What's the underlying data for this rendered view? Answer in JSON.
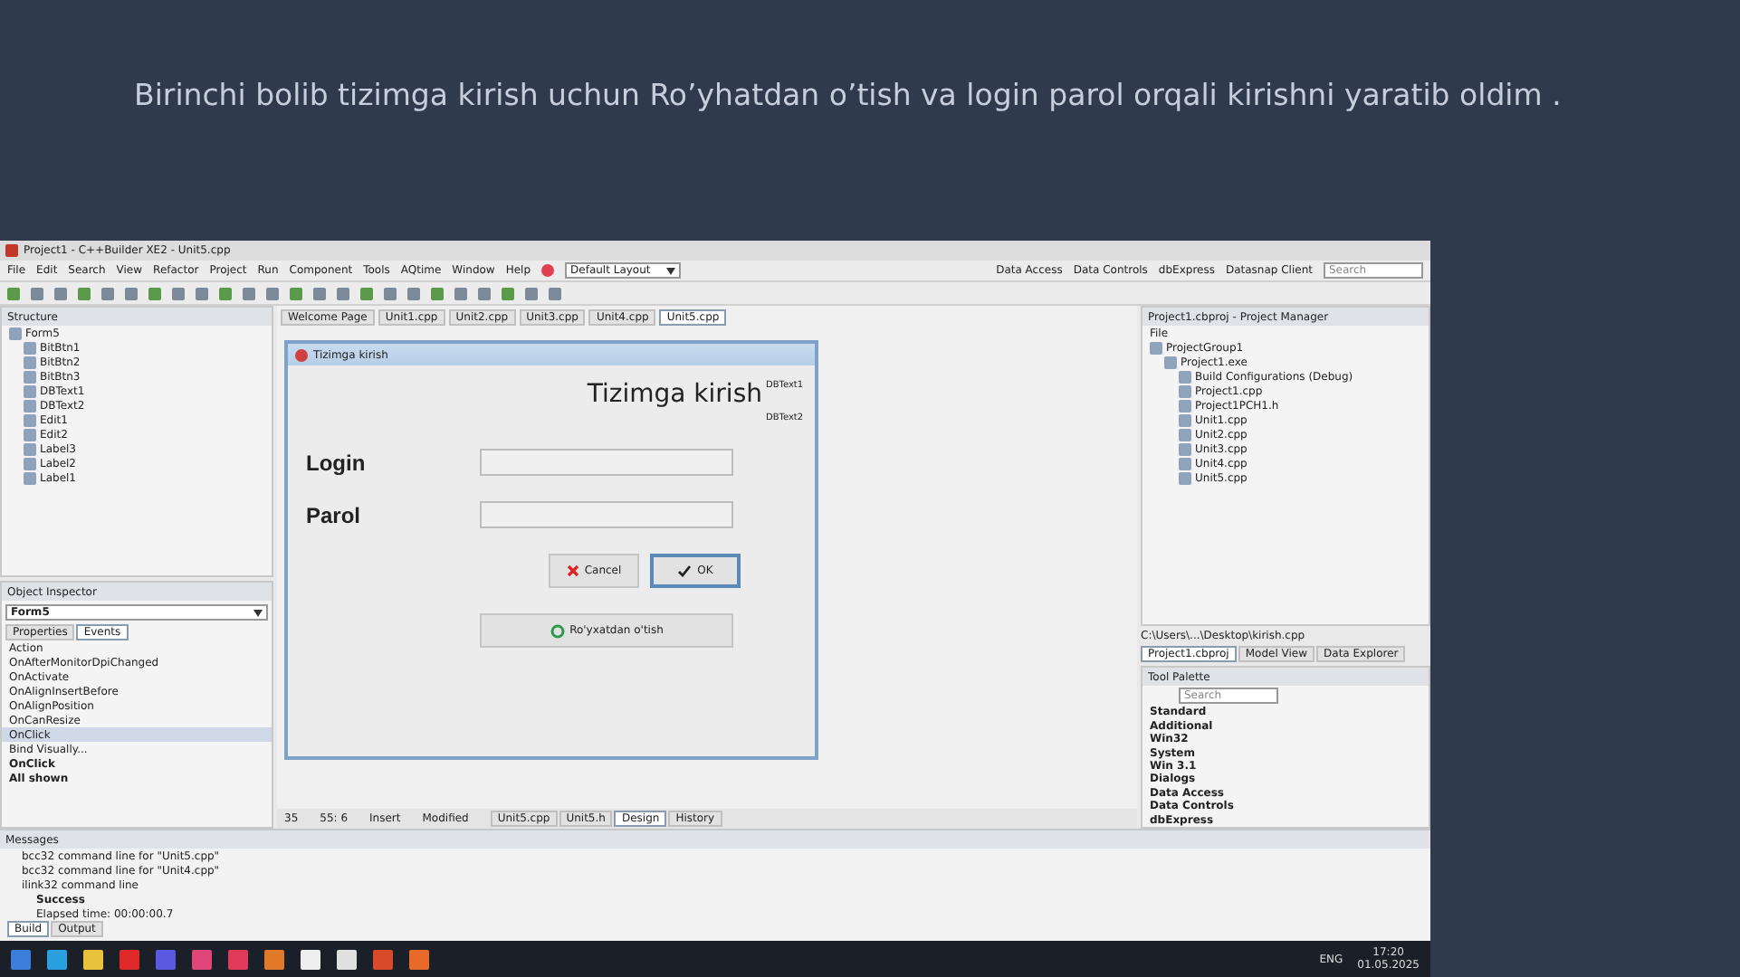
{
  "slide": {
    "title": "Birinchi bolib tizimga kirish uchun Ro’yhatdan o’tish va login parol orqali kirishni yaratib oldim ."
  },
  "ide": {
    "title": "Project1 - C++Builder XE2 - Unit5.cpp",
    "menu": [
      "File",
      "Edit",
      "Search",
      "View",
      "Refactor",
      "Project",
      "Run",
      "Component",
      "Tools",
      "AQtime",
      "Window",
      "Help"
    ],
    "layout": "Default Layout",
    "palette_tabs": [
      "Data Access",
      "Data Controls",
      "dbExpress",
      "Datasnap Client"
    ],
    "search_placeholder": "Search",
    "structure": {
      "title": "Structure",
      "tree": [
        {
          "label": "Form5",
          "children": [
            {
              "label": "BitBtn1"
            },
            {
              "label": "BitBtn2"
            },
            {
              "label": "BitBtn3"
            },
            {
              "label": "DBText1"
            },
            {
              "label": "DBText2"
            },
            {
              "label": "Edit1"
            },
            {
              "label": "Edit2"
            },
            {
              "label": "Label3"
            },
            {
              "label": "Label2"
            },
            {
              "label": "Label1"
            }
          ]
        }
      ]
    },
    "object_inspector": {
      "title": "Object Inspector",
      "object": "Form5",
      "tabs": [
        {
          "label": "Properties",
          "selected": false
        },
        {
          "label": "Events",
          "selected": true
        }
      ],
      "events": [
        {
          "name": "Action",
          "selected": false
        },
        {
          "name": "OnAfterMonitorDpiChanged",
          "selected": false
        },
        {
          "name": "OnActivate",
          "selected": false
        },
        {
          "name": "OnAlignInsertBefore",
          "selected": false
        },
        {
          "name": "OnAlignPosition",
          "selected": false
        },
        {
          "name": "OnCanResize",
          "selected": false
        },
        {
          "name": "OnClick",
          "selected": true
        }
      ],
      "bind": "Bind Visually...",
      "current": "OnClick",
      "filter": "All shown"
    },
    "editor_tabs": [
      {
        "label": "Welcome Page",
        "selected": false
      },
      {
        "label": "Unit1.cpp",
        "selected": false
      },
      {
        "label": "Unit2.cpp",
        "selected": false
      },
      {
        "label": "Unit3.cpp",
        "selected": false
      },
      {
        "label": "Unit4.cpp",
        "selected": false
      },
      {
        "label": "Unit5.cpp",
        "selected": true
      }
    ],
    "form": {
      "caption": "Tizimga kirish",
      "heading": "Tizimga kirish",
      "db_texts": [
        "DBText1",
        "DBText2"
      ],
      "fields": [
        {
          "label": "Login"
        },
        {
          "label": "Parol"
        }
      ],
      "buttons": [
        {
          "label": "Cancel",
          "kind": "cancel",
          "selected": false
        },
        {
          "label": "OK",
          "kind": "ok",
          "selected": true
        }
      ],
      "register_button": "Ro'yxatdan o'tish"
    },
    "status": {
      "line": "35",
      "pos": "55: 6",
      "mode": "Insert",
      "state": "Modified",
      "tabs": [
        {
          "label": "Unit5.cpp",
          "selected": false
        },
        {
          "label": "Unit5.h",
          "selected": false
        },
        {
          "label": "Design",
          "selected": true
        },
        {
          "label": "History",
          "selected": false
        }
      ]
    },
    "project_manager": {
      "title": "Project1.cbproj - Project Manager",
      "header": "File",
      "tree": [
        {
          "label": "ProjectGroup1",
          "children": [
            {
              "label": "Project1.exe",
              "children": [
                {
                  "label": "Build Configurations (Debug)"
                },
                {
                  "label": "Project1.cpp"
                },
                {
                  "label": "Project1PCH1.h"
                },
                {
                  "label": "Unit1.cpp"
                },
                {
                  "label": "Unit2.cpp"
                },
                {
                  "label": "Unit3.cpp"
                },
                {
                  "label": "Unit4.cpp"
                },
                {
                  "label": "Unit5.cpp"
                }
              ]
            }
          ]
        }
      ],
      "path": "C:\\Users\\...\\Desktop\\kirish.cpp",
      "tabs": [
        {
          "label": "Project1.cbproj",
          "selected": true
        },
        {
          "label": "Model View",
          "selected": false
        },
        {
          "label": "Data Explorer",
          "selected": false
        }
      ]
    },
    "tool_palette": {
      "title": "Tool Palette",
      "search_placeholder": "Search",
      "categories": [
        "Standard",
        "Additional",
        "Win32",
        "System",
        "Win 3.1",
        "Dialogs",
        "Data Access",
        "Data Controls",
        "dbExpress"
      ]
    },
    "messages": {
      "title": "Messages",
      "lines": [
        {
          "text": "bcc32 command line for \"Unit5.cpp\"",
          "kind": "cmd"
        },
        {
          "text": "bcc32 command line for \"Unit4.cpp\"",
          "kind": "cmd"
        },
        {
          "text": "ilink32 command line",
          "kind": "cmd"
        },
        {
          "text": "Success",
          "kind": "result"
        },
        {
          "text": "Elapsed time: 00:00:00.7",
          "kind": "info"
        }
      ],
      "tabs": [
        {
          "label": "Build",
          "selected": true
        },
        {
          "label": "Output",
          "selected": false
        }
      ]
    }
  },
  "taskbar": {
    "lang": "ENG",
    "time": "17:20",
    "date": "01.05.2025"
  }
}
